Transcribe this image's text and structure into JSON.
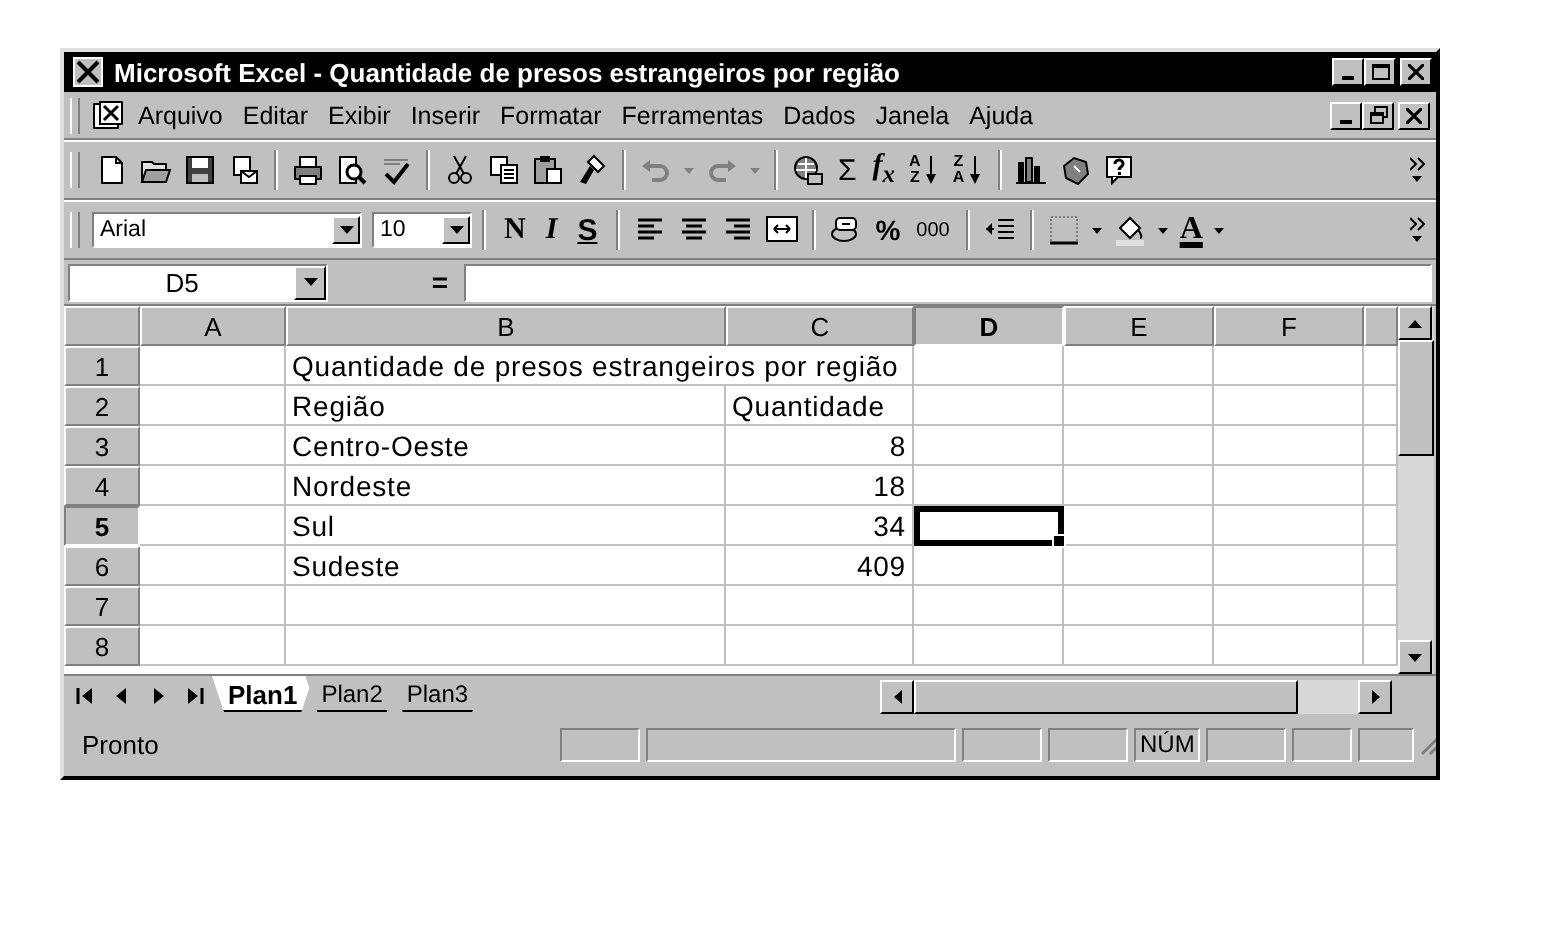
{
  "window": {
    "title": "Microsoft Excel - Quantidade de presos estrangeiros por região"
  },
  "menu": [
    {
      "label": "Arquivo"
    },
    {
      "label": "Editar"
    },
    {
      "label": "Exibir"
    },
    {
      "label": "Inserir"
    },
    {
      "label": "Formatar"
    },
    {
      "label": "Ferramentas"
    },
    {
      "label": "Dados"
    },
    {
      "label": "Janela"
    },
    {
      "label": "Ajuda"
    }
  ],
  "standard_toolbar": {
    "undo": {
      "disabled": true
    },
    "redo": {
      "disabled": true
    },
    "sum": "Σ",
    "function": "f$_{x}$",
    "sort_ascending": [
      "A",
      "Z"
    ],
    "sort_descending": [
      "Z",
      "A"
    ]
  },
  "formatting_toolbar": {
    "font": "Arial",
    "size": "10",
    "bold": "N",
    "italic": "I",
    "underline": "S",
    "percent": "%",
    "thousands": "000",
    "font_color": "A"
  },
  "formula_bar": {
    "name_box": "D5",
    "equals": "="
  },
  "sheet": {
    "columns": [
      {
        "label": "A",
        "selected": false
      },
      {
        "label": "B",
        "selected": false
      },
      {
        "label": "C",
        "selected": false
      },
      {
        "label": "D",
        "selected": true
      },
      {
        "label": "E",
        "selected": false
      },
      {
        "label": "F",
        "selected": false
      }
    ],
    "rows": [
      {
        "header": "1",
        "kind": "title",
        "selected": false,
        "title": "Quantidade de presos estrangeiros por região"
      },
      {
        "header": "2",
        "kind": "heading",
        "selected": false,
        "label": "Região",
        "quantity": "Quantidade"
      },
      {
        "header": "3",
        "kind": "data",
        "selected": false,
        "label": "Centro-Oeste",
        "quantity": "8"
      },
      {
        "header": "4",
        "kind": "data",
        "selected": false,
        "label": "Nordeste",
        "quantity": "18"
      },
      {
        "header": "5",
        "kind": "data",
        "selected": true,
        "label": "Sul",
        "quantity": "34"
      },
      {
        "header": "6",
        "kind": "data",
        "selected": false,
        "label": "Sudeste",
        "quantity": "409"
      },
      {
        "header": "7",
        "kind": "blank",
        "selected": false
      },
      {
        "header": "8",
        "kind": "blank",
        "selected": false
      }
    ]
  },
  "sheet_tabs": [
    {
      "label": "Plan1",
      "selected": true
    },
    {
      "label": "Plan2",
      "selected": false
    },
    {
      "label": "Plan3",
      "selected": false
    }
  ],
  "status_bar": {
    "message": "Pronto",
    "indicator": "NÚM"
  }
}
